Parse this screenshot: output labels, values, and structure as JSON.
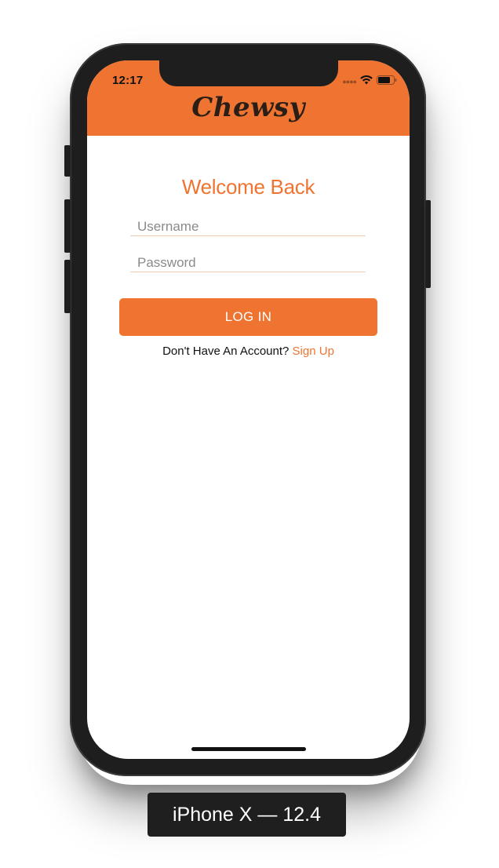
{
  "status_bar": {
    "time": "12:17",
    "icons": [
      "signal-dots-icon",
      "wifi-icon",
      "battery-icon"
    ]
  },
  "app": {
    "logo_text": "Chewsy",
    "brand_color": "#ef7431"
  },
  "login": {
    "heading": "Welcome Back",
    "username_placeholder": "Username",
    "password_placeholder": "Password",
    "login_button_label": "LOG IN",
    "signup_prompt": "Don't Have An Account?",
    "signup_link_label": "Sign Up"
  },
  "simulator": {
    "device_label": "iPhone X — 12.4"
  }
}
